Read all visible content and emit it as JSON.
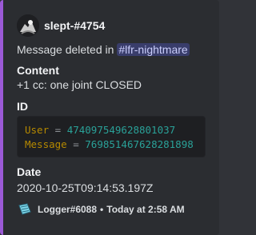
{
  "author": {
    "name": "slept-#4754",
    "avatar_icon": "user-avatar-icon"
  },
  "description": {
    "text": "Message deleted in",
    "channel_mention": "#lfr-nightmare"
  },
  "fields": {
    "content": {
      "name": "Content",
      "value": "+1 cc: one joint CLOSED"
    },
    "id": {
      "name": "ID",
      "lines": [
        {
          "key": "User",
          "eq": "=",
          "value": "474097549628801037"
        },
        {
          "key": "Message",
          "eq": "=",
          "value": "769851467628281898"
        }
      ]
    },
    "date": {
      "name": "Date",
      "value": "2020-10-25T09:14:53.197Z"
    }
  },
  "footer": {
    "icon": "logger-icon",
    "bot_name": "Logger#6088",
    "separator": "•",
    "time": "Today at 2:58 AM"
  },
  "colors": {
    "accent": "#9b59d6",
    "embed_bg": "#2b2d31"
  }
}
